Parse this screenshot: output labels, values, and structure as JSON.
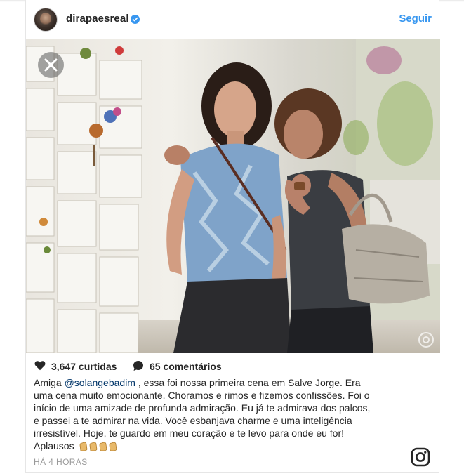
{
  "post": {
    "username": "dirapaesreal",
    "follow_label": "Seguir",
    "likes_label": "3,647 curtidas",
    "comments_label": "65 comentários",
    "caption": {
      "line1_before": "Amiga ",
      "mention": "@solangebadim",
      "line1_after": " , essa foi nossa primeira cena em Salve Jorge. Era",
      "line2": "uma cena muito emocionante. Choramos e rimos e fizemos confissões. Foi o",
      "line3": "início de uma amizade de profunda admiração. Eu já te admirava dos palcos,",
      "line4": "e passei a te admirar na vida. Você esbanjava charme e uma inteligência",
      "line5": "irresistível. Hoje, te guardo em meu coração e te levo para onde eu for!",
      "line6": "Aplausos"
    },
    "timestamp": "HÁ 4 HORAS",
    "clap_emoji_count": 4
  },
  "icons": {
    "verified": "verified-badge-icon",
    "close": "close-icon",
    "heart": "heart-icon",
    "comment": "comment-bubble-icon",
    "clap": "clapping-hands-icon",
    "brand": "instagram-glyph-icon",
    "watermark": "globo-watermark-icon"
  },
  "colors": {
    "link_blue": "#3897f0",
    "mention_blue": "#003569",
    "text": "#262626",
    "muted": "#999999"
  }
}
